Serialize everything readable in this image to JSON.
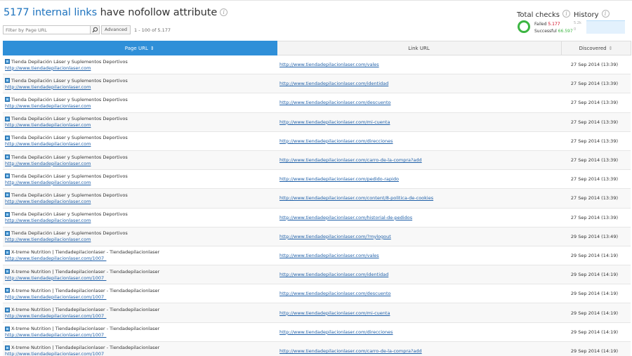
{
  "header": {
    "count": "5177 internal links",
    "rest": " have nofollow attribute"
  },
  "filter": {
    "placeholder": "Filter by Page URL"
  },
  "advanced_label": "Advanced",
  "range": "1 - 100 of 5.177",
  "total_checks": {
    "title": "Total checks",
    "failed_label": "Failed",
    "failed_value": "5.177",
    "successful_label": "Successful",
    "successful_value": "66.597"
  },
  "history": {
    "title": "History",
    "y1": "5.2k",
    "y2": "0"
  },
  "columns": {
    "page_url": "Page URL",
    "link_url": "Link URL",
    "discovered": "Discovered"
  },
  "rows": [
    {
      "title": "Tienda Depilación Láser y Suplementos Deportivos",
      "page": "http://www.tiendadepilacionlaser.com",
      "link": "http://www.tiendadepilacionlaser.com/vales",
      "date": "27 Sep 2014 (13:39)"
    },
    {
      "title": "Tienda Depilación Láser y Suplementos Deportivos",
      "page": "http://www.tiendadepilacionlaser.com",
      "link": "http://www.tiendadepilacionlaser.com/identidad",
      "date": "27 Sep 2014 (13:39)"
    },
    {
      "title": "Tienda Depilación Láser y Suplementos Deportivos",
      "page": "http://www.tiendadepilacionlaser.com",
      "link": "http://www.tiendadepilacionlaser.com/descuento",
      "date": "27 Sep 2014 (13:39)"
    },
    {
      "title": "Tienda Depilación Láser y Suplementos Deportivos",
      "page": "http://www.tiendadepilacionlaser.com",
      "link": "http://www.tiendadepilacionlaser.com/mi-cuenta",
      "date": "27 Sep 2014 (13:39)"
    },
    {
      "title": "Tienda Depilación Láser y Suplementos Deportivos",
      "page": "http://www.tiendadepilacionlaser.com",
      "link": "http://www.tiendadepilacionlaser.com/direcciones",
      "date": "27 Sep 2014 (13:39)"
    },
    {
      "title": "Tienda Depilación Láser y Suplementos Deportivos",
      "page": "http://www.tiendadepilacionlaser.com",
      "link": "http://www.tiendadepilacionlaser.com/carro-de-la-compra?add",
      "date": "27 Sep 2014 (13:39)"
    },
    {
      "title": "Tienda Depilación Láser y Suplementos Deportivos",
      "page": "http://www.tiendadepilacionlaser.com",
      "link": "http://www.tiendadepilacionlaser.com/pedido-rapido",
      "date": "27 Sep 2014 (13:39)"
    },
    {
      "title": "Tienda Depilación Láser y Suplementos Deportivos",
      "page": "http://www.tiendadepilacionlaser.com",
      "link": "http://www.tiendadepilacionlaser.com/content/8-politica-de-cookies",
      "date": "27 Sep 2014 (13:39)"
    },
    {
      "title": "Tienda Depilación Láser y Suplementos Deportivos",
      "page": "http://www.tiendadepilacionlaser.com",
      "link": "http://www.tiendadepilacionlaser.com/historial-de-pedidos",
      "date": "27 Sep 2014 (13:39)"
    },
    {
      "title": "Tienda Depilación Láser y Suplementos Deportivos",
      "page": "http://www.tiendadepilacionlaser.com",
      "link": "http://www.tiendadepilacionlaser.com/?mylogout",
      "date": "29 Sep 2014 (13:49)"
    },
    {
      "title": "X-treme Nutrition | Tiendadepilacionlaser - Tiendadepilacionlaser",
      "page": "http://www.tiendadepilacionlaser.com/1007_",
      "link": "http://www.tiendadepilacionlaser.com/vales",
      "date": "29 Sep 2014 (14:19)"
    },
    {
      "title": "X-treme Nutrition | Tiendadepilacionlaser - Tiendadepilacionlaser",
      "page": "http://www.tiendadepilacionlaser.com/1007_",
      "link": "http://www.tiendadepilacionlaser.com/identidad",
      "date": "29 Sep 2014 (14:19)"
    },
    {
      "title": "X-treme Nutrition | Tiendadepilacionlaser - Tiendadepilacionlaser",
      "page": "http://www.tiendadepilacionlaser.com/1007_",
      "link": "http://www.tiendadepilacionlaser.com/descuento",
      "date": "29 Sep 2014 (14:19)"
    },
    {
      "title": "X-treme Nutrition | Tiendadepilacionlaser - Tiendadepilacionlaser",
      "page": "http://www.tiendadepilacionlaser.com/1007_",
      "link": "http://www.tiendadepilacionlaser.com/mi-cuenta",
      "date": "29 Sep 2014 (14:19)"
    },
    {
      "title": "X-treme Nutrition | Tiendadepilacionlaser - Tiendadepilacionlaser",
      "page": "http://www.tiendadepilacionlaser.com/1007_",
      "link": "http://www.tiendadepilacionlaser.com/direcciones",
      "date": "29 Sep 2014 (14:19)"
    },
    {
      "title": "X-treme Nutrition | Tiendadepilacionlaser - Tiendadepilacionlaser",
      "page": "http://www.tiendadepilacionlaser.com/1007_",
      "link": "http://www.tiendadepilacionlaser.com/carro-de-la-compra?add",
      "date": "29 Sep 2014 (14:19)"
    }
  ]
}
